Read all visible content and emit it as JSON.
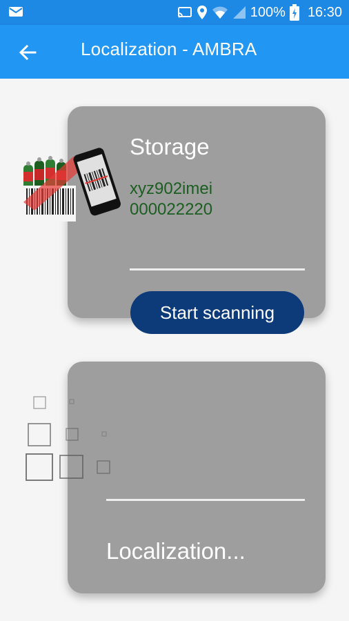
{
  "status_bar": {
    "battery_text": "100%",
    "time": "16:30",
    "icons": [
      "mail-icon",
      "cast-icon",
      "location-icon",
      "wifi-icon",
      "signal-icon",
      "battery-charging-icon"
    ]
  },
  "app_bar": {
    "title": "Localization - AMBRA",
    "back_icon": "arrow-left-icon"
  },
  "storage_card": {
    "title": "Storage",
    "line1": "xyz902imei",
    "line2": "000022220",
    "button_label": "Start scanning",
    "image": "barcode-scanning-illustration"
  },
  "localization_card": {
    "status_text": "Localization...",
    "image": "loading-squares-animation"
  },
  "colors": {
    "app_bar": "#2196f3",
    "status_bar": "#1e88e5",
    "card": "#9e9e9e",
    "button": "#0d3b7a",
    "storage_text": "#1b5e20"
  }
}
